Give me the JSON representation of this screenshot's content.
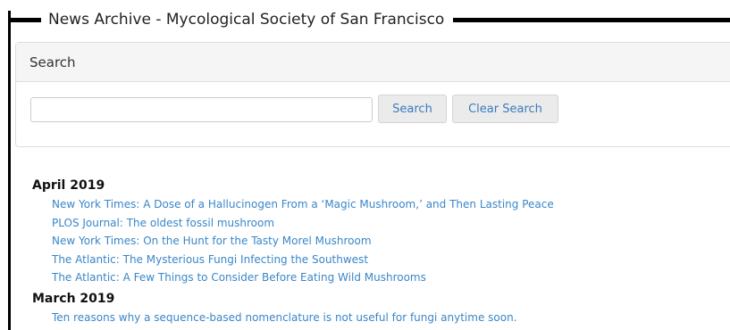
{
  "page": {
    "title": "News Archive - Mycological Society of San Francisco"
  },
  "search": {
    "heading": "Search",
    "input_value": "",
    "search_label": "Search",
    "clear_label": "Clear Search"
  },
  "archive": {
    "months": [
      {
        "label": "April 2019",
        "items": [
          "New York Times: A Dose of a Hallucinogen From a ‘Magic Mushroom,’ and Then Lasting Peace",
          "PLOS Journal: The oldest fossil mushroom",
          "New York Times: On the Hunt for the Tasty Morel Mushroom",
          "The Atlantic: The Mysterious Fungi Infecting the Southwest",
          "The Atlantic: A Few Things to Consider Before Eating Wild Mushrooms"
        ]
      },
      {
        "label": "March 2019",
        "items": [
          "Ten reasons why a sequence-based nomenclature is not useful for fungi anytime soon."
        ]
      }
    ]
  }
}
